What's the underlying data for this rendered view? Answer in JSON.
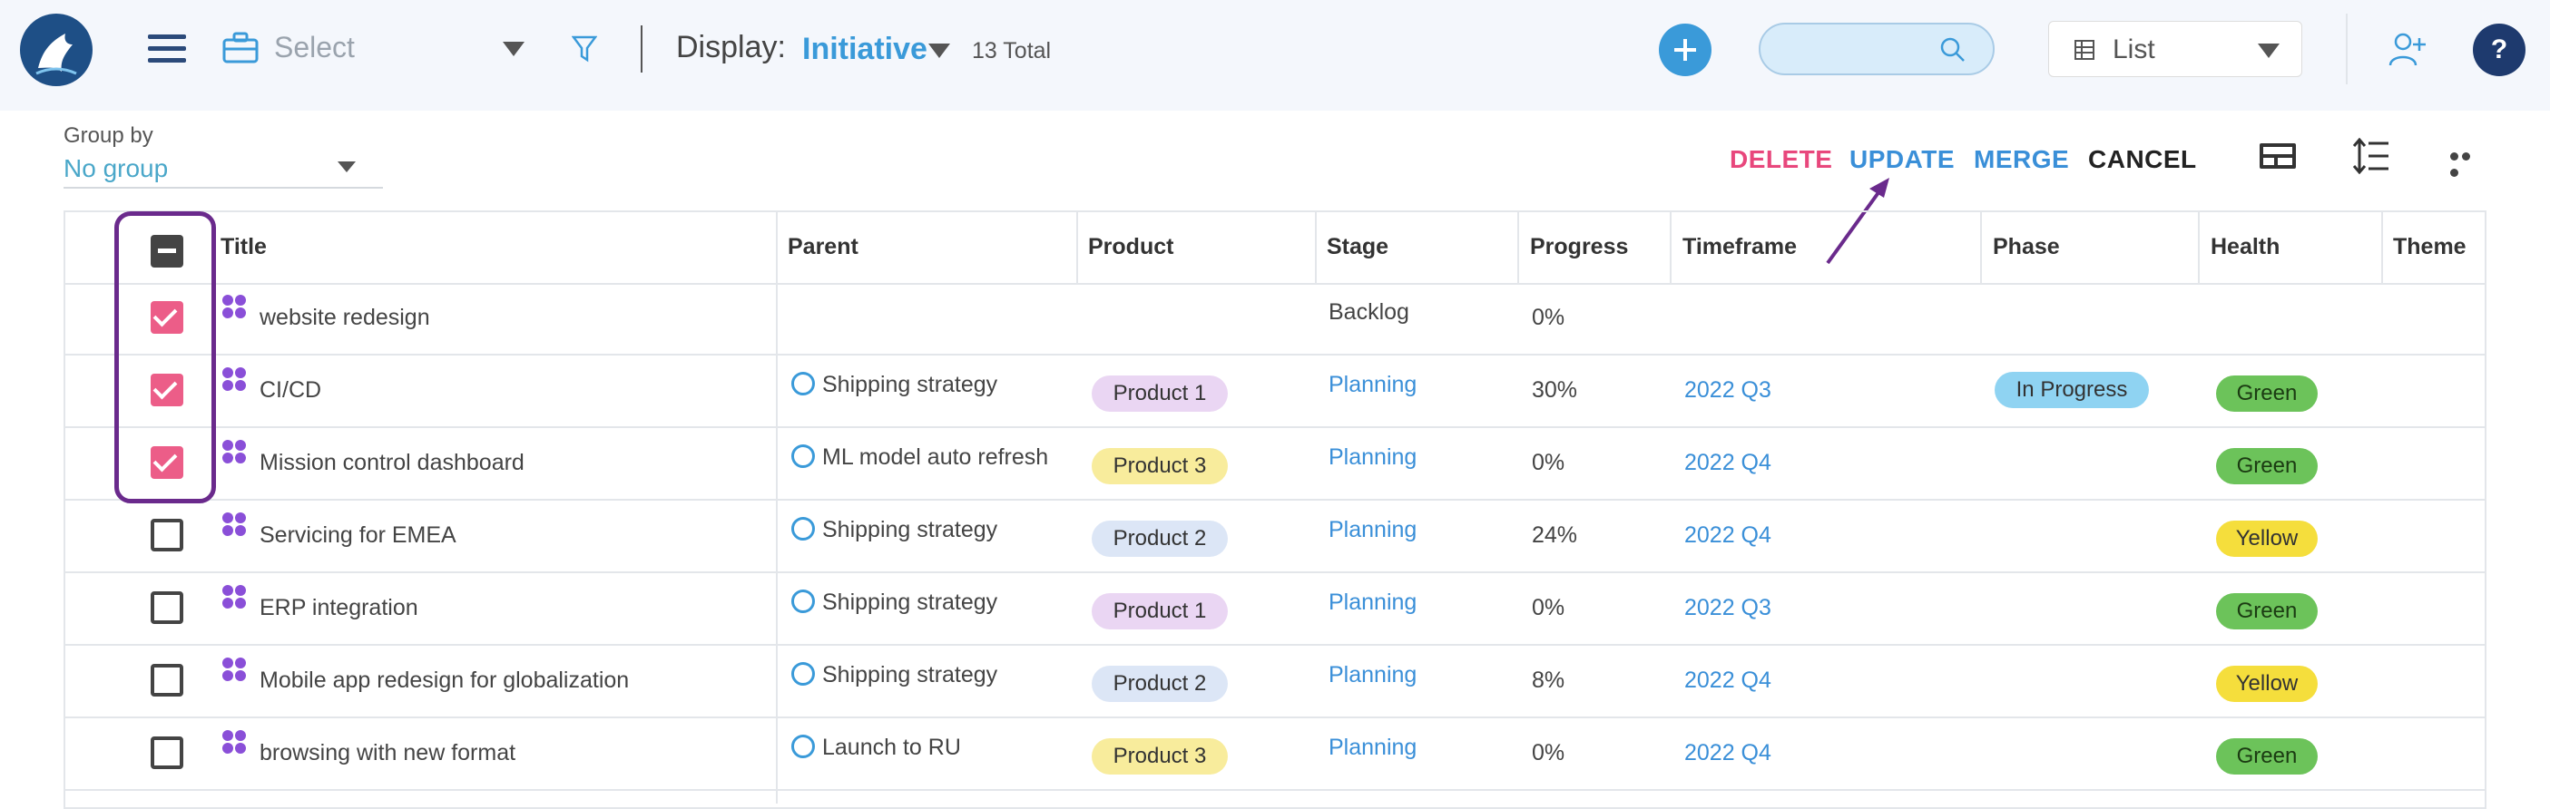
{
  "header": {
    "select_placeholder": "Select",
    "display_label": "Display:",
    "display_value": "Initiative",
    "total": "13 Total",
    "search_placeholder": "",
    "view_select": "List",
    "help_label": "?"
  },
  "group_by": {
    "label": "Group by",
    "value": "No group"
  },
  "actions": {
    "delete": "DELETE",
    "update": "UPDATE",
    "merge": "MERGE",
    "cancel": "CANCEL"
  },
  "colors": {
    "accent": "#3a9ad9",
    "delete": "#e8477c",
    "checked": "#ec5d88",
    "annotation": "#6a2a8c"
  },
  "columns": [
    "Title",
    "Parent",
    "Product",
    "Stage",
    "Progress",
    "Timeframe",
    "Phase",
    "Health",
    "Theme"
  ],
  "rows": [
    {
      "checked": true,
      "title": "website redesign",
      "parent": "",
      "product": "",
      "stage": "Backlog",
      "progress": "0%",
      "timeframe": "",
      "phase": "",
      "health": ""
    },
    {
      "checked": true,
      "title": "CI/CD",
      "parent": "Shipping strategy",
      "product": "Product 1",
      "stage": "Planning",
      "progress": "30%",
      "timeframe": "2022 Q3",
      "phase": "In Progress",
      "health": "Green"
    },
    {
      "checked": true,
      "title": "Mission control dashboard",
      "parent": "ML model auto refresh",
      "product": "Product 3",
      "stage": "Planning",
      "progress": "0%",
      "timeframe": "2022 Q4",
      "phase": "",
      "health": "Green"
    },
    {
      "checked": false,
      "title": "Servicing for EMEA",
      "parent": "Shipping strategy",
      "product": "Product 2",
      "stage": "Planning",
      "progress": "24%",
      "timeframe": "2022 Q4",
      "phase": "",
      "health": "Yellow"
    },
    {
      "checked": false,
      "title": "ERP integration",
      "parent": "Shipping strategy",
      "product": "Product 1",
      "stage": "Planning",
      "progress": "0%",
      "timeframe": "2022 Q3",
      "phase": "",
      "health": "Green"
    },
    {
      "checked": false,
      "title": "Mobile app redesign for globalization",
      "parent": "Shipping strategy",
      "product": "Product 2",
      "stage": "Planning",
      "progress": "8%",
      "timeframe": "2022 Q4",
      "phase": "",
      "health": "Yellow"
    },
    {
      "checked": false,
      "title": "browsing with new format",
      "parent": "Launch to RU",
      "product": "Product 3",
      "stage": "Planning",
      "progress": "0%",
      "timeframe": "2022 Q4",
      "phase": "",
      "health": "Green"
    }
  ]
}
